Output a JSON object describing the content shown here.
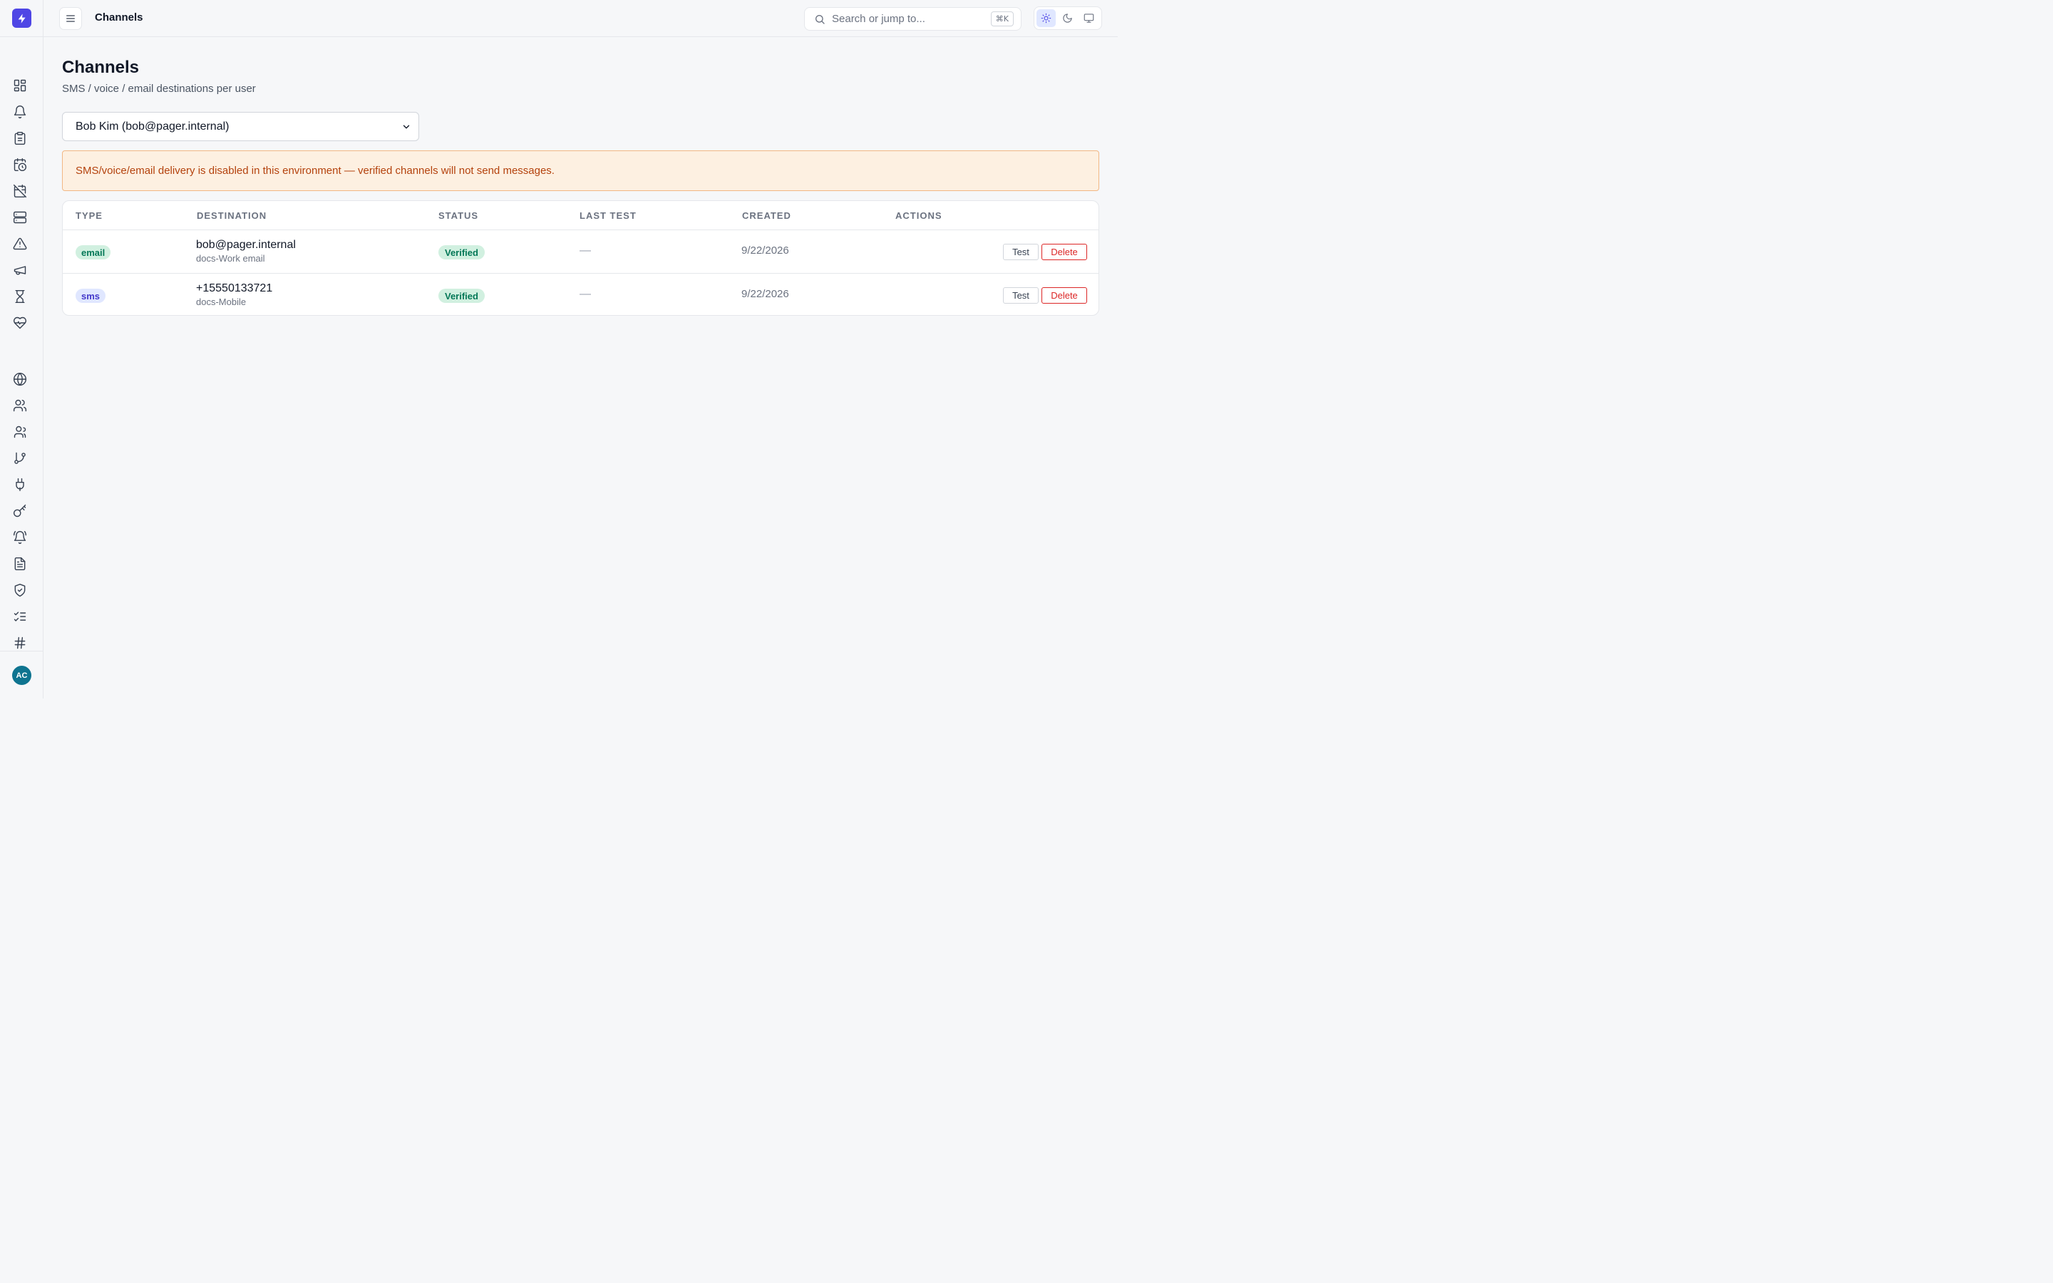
{
  "topbar": {
    "title": "Channels",
    "search_placeholder": "Search or jump to...",
    "shortcut": "⌘K",
    "theme_options": [
      "light",
      "dark",
      "system"
    ],
    "active_theme": "light"
  },
  "sidebar": {
    "logo": "bolt-icon",
    "nav_items": [
      "dashboard-icon",
      "bell-icon",
      "clipboard-icon",
      "calendar-clock-icon",
      "calendar-off-icon",
      "server-icon",
      "alert-triangle-icon",
      "megaphone-icon",
      "hourglass-icon",
      "heart-pulse-icon",
      "globe-icon",
      "users-icon",
      "team-icon",
      "git-branch-icon",
      "plug-icon",
      "key-icon",
      "bell-ring-icon",
      "file-text-icon",
      "shield-check-icon",
      "list-checks-icon",
      "hash-icon"
    ],
    "avatar_initials": "AC"
  },
  "page": {
    "title": "Channels",
    "subtitle": "SMS / voice / email destinations per user",
    "user_select": "Bob Kim (bob@pager.internal)",
    "banner": "SMS/voice/email delivery is disabled in this environment — verified channels will not send messages."
  },
  "table": {
    "headers": {
      "type": "Type",
      "destination": "Destination",
      "status": "Status",
      "last_test": "Last Test",
      "created": "Created",
      "actions": "Actions"
    },
    "rows": [
      {
        "type": "email",
        "destination": "bob@pager.internal",
        "label": "docs-Work email",
        "status": "Verified",
        "last_test": "—",
        "created": "9/22/2026",
        "test": "Test",
        "delete": "Delete"
      },
      {
        "type": "sms",
        "destination": "+15550133721",
        "label": "docs-Mobile",
        "status": "Verified",
        "last_test": "—",
        "created": "9/22/2026",
        "test": "Test",
        "delete": "Delete"
      }
    ]
  },
  "colors": {
    "accent": "#4f46e5",
    "success": "#047857",
    "danger": "#dc2626",
    "warning_text": "#b4420d",
    "warning_bg": "#fdf0e1"
  }
}
